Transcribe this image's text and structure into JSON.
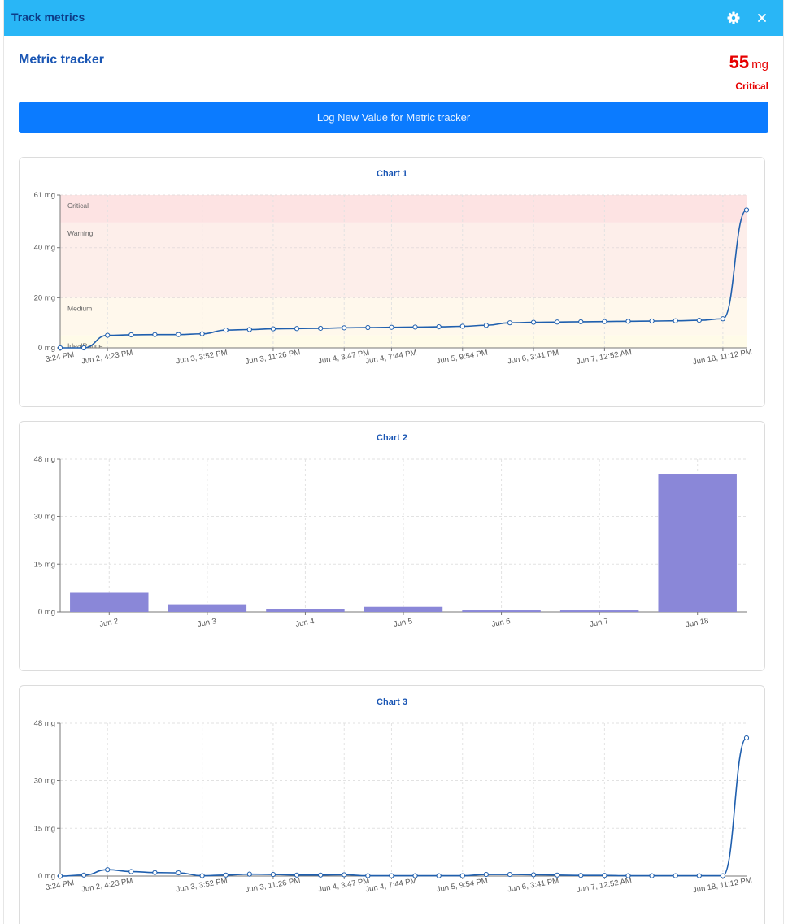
{
  "window": {
    "title": "Track metrics"
  },
  "icons": {
    "settings": "gear-icon",
    "close": "close-icon"
  },
  "metric": {
    "name": "Metric tracker",
    "value": "55",
    "unit": "mg",
    "status": "Critical",
    "status_color": "#e60000"
  },
  "actions": {
    "log_label": "Log New Value for Metric tracker"
  },
  "colors": {
    "accent": "#29b6f6",
    "button": "#0b7bff",
    "line": "#1f5fae",
    "bar": "#8a87d8"
  },
  "chart_data": [
    {
      "type": "line",
      "title": "Chart 1",
      "ylim": [
        0,
        61
      ],
      "yticks": [
        0,
        20,
        40,
        61
      ],
      "ytick_labels": [
        "0 mg",
        "20 mg",
        "40 mg",
        "61 mg"
      ],
      "xtick_labels": [
        "3:24 PM",
        "Jun 2, 4:23 PM",
        "Jun 3, 3:52 PM",
        "Jun 3, 11:26 PM",
        "Jun 4, 3:47 PM",
        "Jun 4, 7:44 PM",
        "Jun 5, 9:54 PM",
        "Jun 6, 3:41 PM",
        "Jun 7, 12:52 AM",
        "Jun 18, 11:12 PM"
      ],
      "xtick_index": [
        0,
        2,
        6,
        9,
        12,
        14,
        17,
        20,
        23,
        28
      ],
      "bands": [
        {
          "label": "Critical",
          "from": 50,
          "to": 61,
          "color": "#fde3e3"
        },
        {
          "label": "Warning",
          "from": 20,
          "to": 50,
          "color": "#fdeeea"
        },
        {
          "label": "Medium",
          "from": 5,
          "to": 20,
          "color": "#fff8ec"
        },
        {
          "label": "IdealRange",
          "from": 0,
          "to": 5,
          "color": "#fffbe8"
        }
      ],
      "values": [
        0,
        0,
        5,
        5.2,
        5.3,
        5.3,
        5.6,
        7.1,
        7.3,
        7.6,
        7.7,
        7.8,
        8.0,
        8.1,
        8.2,
        8.3,
        8.4,
        8.6,
        9.0,
        10.0,
        10.2,
        10.3,
        10.4,
        10.5,
        10.6,
        10.7,
        10.8,
        11.0,
        11.6,
        55
      ]
    },
    {
      "type": "bar",
      "title": "Chart 2",
      "ylim": [
        0,
        48
      ],
      "yticks": [
        0,
        15,
        30,
        48
      ],
      "ytick_labels": [
        "0 mg",
        "15 mg",
        "30 mg",
        "48 mg"
      ],
      "categories": [
        "Jun 2",
        "Jun 3",
        "Jun 4",
        "Jun 5",
        "Jun 6",
        "Jun 7",
        "Jun 18"
      ],
      "values": [
        6.0,
        2.4,
        0.8,
        1.6,
        0.5,
        0.5,
        43.4
      ]
    },
    {
      "type": "line",
      "title": "Chart 3",
      "ylim": [
        0,
        48
      ],
      "yticks": [
        0,
        15,
        30,
        48
      ],
      "ytick_labels": [
        "0 mg",
        "15 mg",
        "30 mg",
        "48 mg"
      ],
      "xtick_labels": [
        "3:24 PM",
        "Jun 2, 4:23 PM",
        "Jun 3, 3:52 PM",
        "Jun 3, 11:26 PM",
        "Jun 4, 3:47 PM",
        "Jun 4, 7:44 PM",
        "Jun 5, 9:54 PM",
        "Jun 6, 3:41 PM",
        "Jun 7, 12:52 AM",
        "Jun 18, 11:12 PM"
      ],
      "xtick_index": [
        0,
        2,
        6,
        9,
        12,
        14,
        17,
        20,
        23,
        28
      ],
      "values": [
        0,
        0.3,
        2.0,
        1.4,
        1.1,
        1.0,
        0.1,
        0.3,
        0.6,
        0.5,
        0.3,
        0.3,
        0.4,
        0.1,
        0.1,
        0.1,
        0.1,
        0.1,
        0.5,
        0.5,
        0.4,
        0.3,
        0.2,
        0.2,
        0.1,
        0.1,
        0.1,
        0.1,
        0.1,
        43.4
      ]
    }
  ]
}
